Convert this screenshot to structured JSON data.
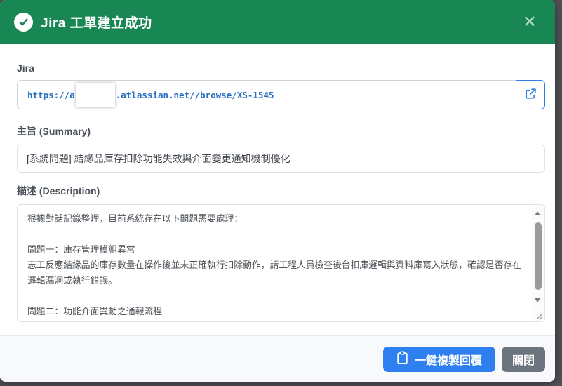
{
  "modal": {
    "header": {
      "title": "Jira 工單建立成功",
      "close_glyph": "✕"
    },
    "jira": {
      "label": "Jira",
      "url_visible_prefix": "https://a",
      "url_visible_suffix": ".atlassian.net//browse/XS-1545"
    },
    "summary": {
      "label": "主旨 (Summary)",
      "value": "[系統問題] 結緣品庫存扣除功能失效與介面變更通知機制優化"
    },
    "description": {
      "label": "描述 (Description)",
      "value": "根據對話記錄整理，目前系統存在以下問題需要處理：\n\n問題一：庫存管理模組異常\n志工反應結緣品的庫存數量在操作後並未正確執行扣除動作，請工程人員檢查後台扣庫邏輯與資料庫寫入狀態，確認是否存在邏輯漏洞或執行錯誤。\n\n問題二：功能介面異動之通報流程\n會計人員反應系統功能位置調整後未收到任何事前通知，導致作業流程中斷與尋找功能的困擾。建議開發團隊在未來異動 UI/UX 位置時，應透過系統公告或更新日誌主動告知使用者，以提升使用者體驗。"
    },
    "footer": {
      "copy_button_label": "一鍵複製回覆",
      "close_button_label": "關閉"
    },
    "colors": {
      "header_green": "#198754",
      "primary_blue": "#2e80f0",
      "secondary_gray": "#6c757d",
      "url_link_blue": "#2a6fc2"
    }
  }
}
